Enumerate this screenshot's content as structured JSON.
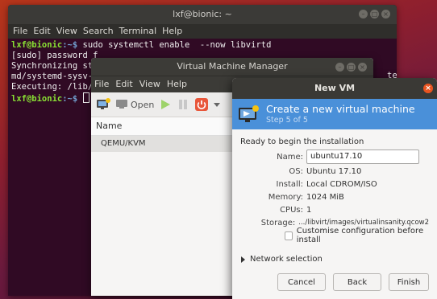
{
  "terminal": {
    "title": "lxf@bionic: ~",
    "menu": [
      "File",
      "Edit",
      "View",
      "Search",
      "Terminal",
      "Help"
    ],
    "lines": [
      {
        "user": "lxf@bionic",
        "path": ":~$ ",
        "cmd": "sudo systemctl enable  --now libvirtd"
      },
      {
        "text": "[sudo] password f"
      },
      {
        "text": "Synchronizing sta"
      },
      {
        "text": "md/systemd-sysv-i"
      },
      {
        "text": "Executing: /lib/s"
      }
    ],
    "prompt_user": "lxf@bionic",
    "prompt_path": ":~$ ",
    "side_text": "te"
  },
  "vmm": {
    "title": "Virtual Machine Manager",
    "menu": [
      "File",
      "Edit",
      "View",
      "Help"
    ],
    "toolbar": {
      "open_label": "Open"
    },
    "list_header": "Name",
    "connection": "QEMU/KVM"
  },
  "newvm": {
    "title": "New VM",
    "banner_title": "Create a new virtual machine",
    "banner_step": "Step 5 of 5",
    "ready_text": "Ready to begin the installation",
    "name_label": "Name:",
    "name_value": "ubuntu17.10",
    "os_label": "OS:",
    "os_value": "Ubuntu 17.10",
    "install_label": "Install:",
    "install_value": "Local CDROM/ISO",
    "memory_label": "Memory:",
    "memory_value": "1024 MiB",
    "cpus_label": "CPUs:",
    "cpus_value": "1",
    "storage_label": "Storage:",
    "storage_value": ".../libvirt/images/virtualinsanity.qcow2",
    "customise_label": "Customise configuration before install",
    "network_label": "Network selection",
    "cancel_label": "Cancel",
    "back_label": "Back",
    "finish_label": "Finish"
  },
  "colors": {
    "terminal_bg": "#300a24",
    "banner_bg": "#4a90d9",
    "accent": "#e95420"
  }
}
